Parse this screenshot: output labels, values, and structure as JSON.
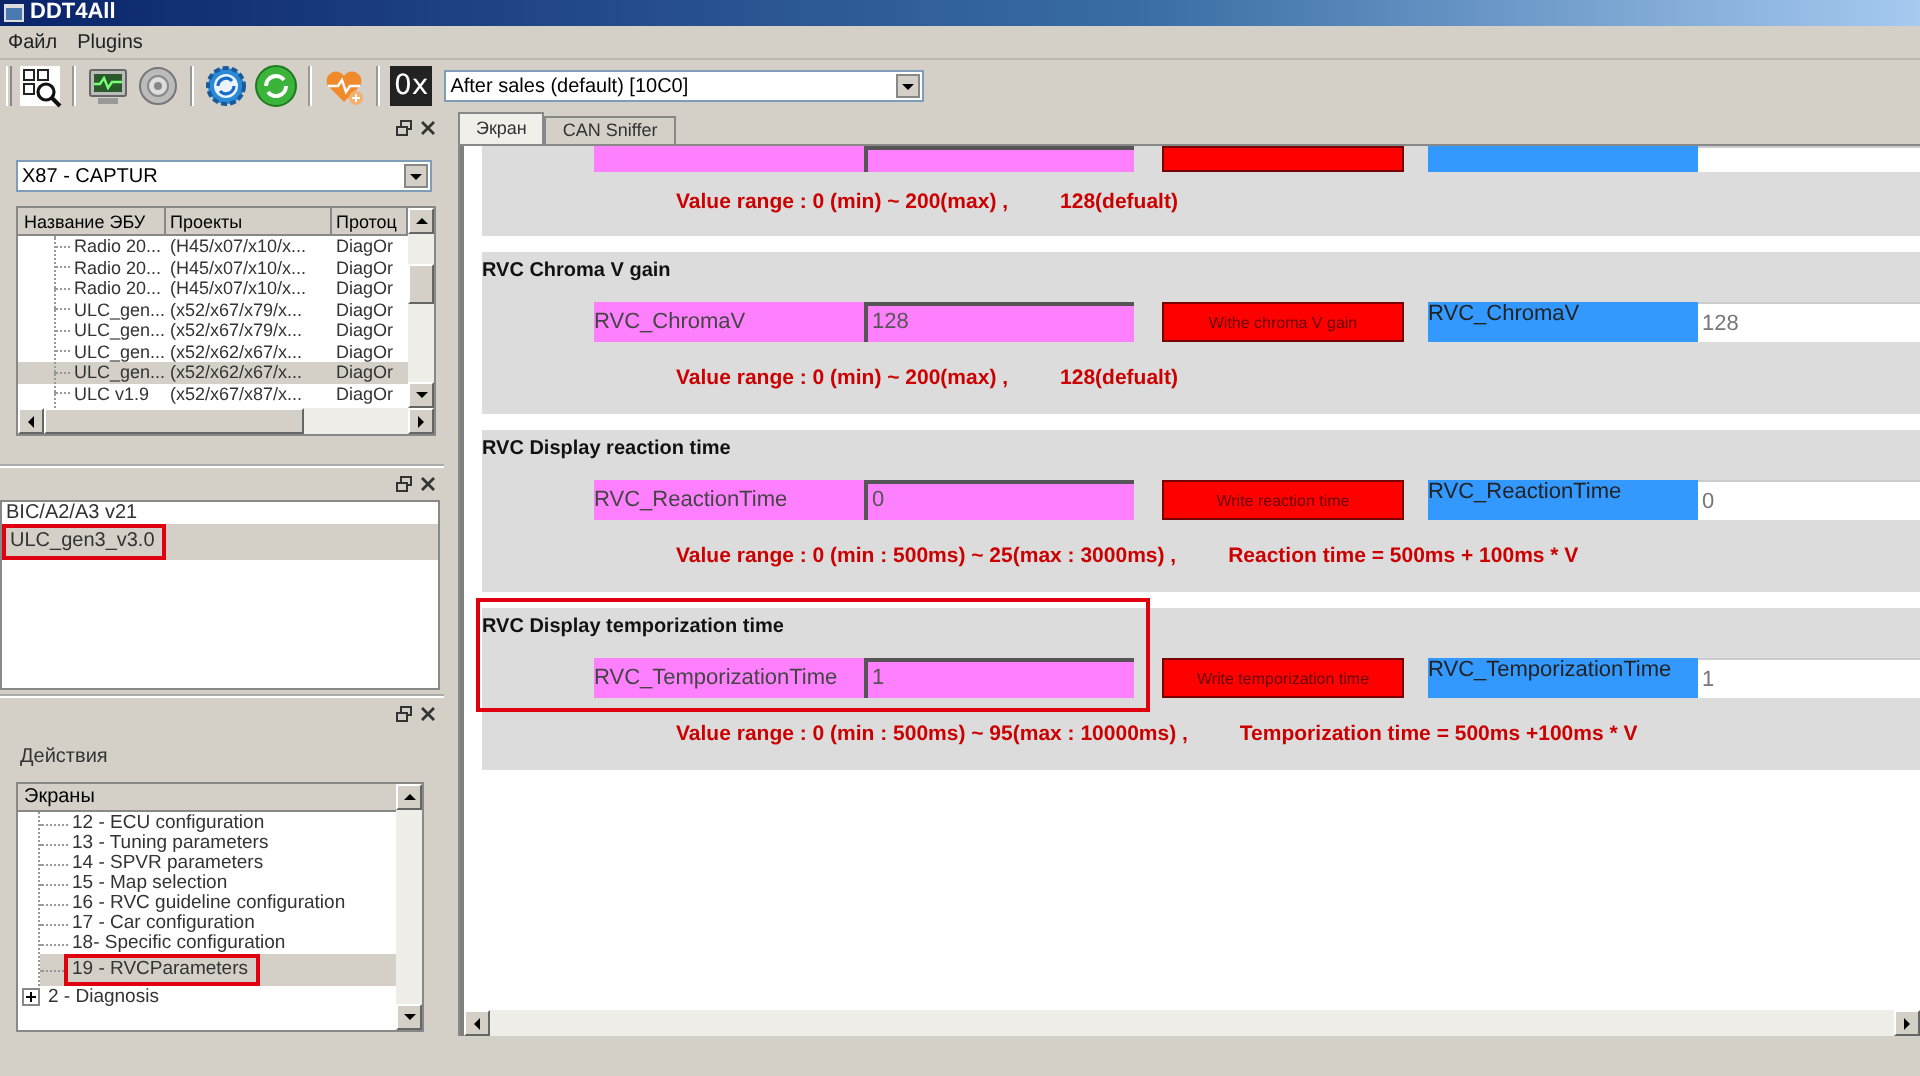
{
  "window": {
    "title": "DDT4All"
  },
  "menu": [
    {
      "label": "Файл"
    },
    {
      "label": "Plugins"
    }
  ],
  "toolbar": {
    "groups": [
      [
        {
          "kind": "scan"
        }
      ],
      [
        {
          "kind": "monitor"
        },
        {
          "kind": "disc"
        }
      ],
      [
        {
          "kind": "gear-sync"
        },
        {
          "kind": "sync"
        }
      ],
      [
        {
          "kind": "heart"
        }
      ],
      [
        {
          "kind": "hex",
          "label": "0x"
        }
      ]
    ],
    "session": "After sales (default) [10C0]"
  },
  "ecu_panel": {
    "vehicle": "X87 - CAPTUR",
    "columns": [
      "Название ЭБУ",
      "Проекты",
      "Протоц"
    ],
    "rows": [
      {
        "name": "Radio 20...",
        "projects": "(H45/x07/x10/x...",
        "protocol": "DiagOr",
        "selected": false
      },
      {
        "name": "Radio 20...",
        "projects": "(H45/x07/x10/x...",
        "protocol": "DiagOr",
        "selected": false
      },
      {
        "name": "Radio 20...",
        "projects": "(H45/x07/x10/x...",
        "protocol": "DiagOr",
        "selected": false
      },
      {
        "name": "ULC_gen...",
        "projects": "(x52/x67/x79/x...",
        "protocol": "DiagOr",
        "selected": false
      },
      {
        "name": "ULC_gen...",
        "projects": "(x52/x67/x79/x...",
        "protocol": "DiagOr",
        "selected": false
      },
      {
        "name": "ULC_gen...",
        "projects": "(x52/x62/x67/x...",
        "protocol": "DiagOr",
        "selected": false
      },
      {
        "name": "ULC_gen...",
        "projects": "(x52/x62/x67/x...",
        "protocol": "DiagOr",
        "selected": true
      },
      {
        "name": "ULC v1.9",
        "projects": "(x52/x67/x87/x...",
        "protocol": "DiagOr",
        "selected": false
      }
    ]
  },
  "ecu_list": {
    "items": [
      {
        "label": "BIC/A2/A3 v21",
        "selected": false,
        "annotated": false
      },
      {
        "label": "ULC_gen3_v3.0",
        "selected": true,
        "annotated": true
      }
    ]
  },
  "actions_panel": {
    "title": "Действия",
    "column": "Экраны",
    "nodes": [
      {
        "children": [
          {
            "label": "12 - ECU configuration",
            "selected": false,
            "annotated": false
          },
          {
            "label": "13 - Tuning parameters",
            "selected": false,
            "annotated": false
          },
          {
            "label": "14 - SPVR parameters",
            "selected": false,
            "annotated": false
          },
          {
            "label": "15 - Map selection",
            "selected": false,
            "annotated": false
          },
          {
            "label": "16 - RVC guideline configuration",
            "selected": false,
            "annotated": false
          },
          {
            "label": "17 - Car configuration",
            "selected": false,
            "annotated": false
          },
          {
            "label": "18- Specific configuration",
            "selected": false,
            "annotated": false
          },
          {
            "label": "19 - RVCParameters",
            "selected": true,
            "annotated": true
          }
        ]
      },
      {
        "label": "2 - Diagnosis",
        "expanded": false
      }
    ]
  },
  "tabs": [
    {
      "label": "Экран",
      "selected": true
    },
    {
      "label": "CAN Sniffer",
      "selected": false
    }
  ],
  "sections": [
    {
      "cut": true,
      "annotated": false,
      "range": "Value range : 0 (min) ~ 200(max) ,",
      "note": "128(defualt)"
    },
    {
      "cut": false,
      "annotated": false,
      "title": "RVC Chroma V gain",
      "label": "RVC_ChromaV",
      "value": "128",
      "button": "Withe chroma V gain",
      "reading_label": "RVC_ChromaV",
      "reading_value": "128",
      "range": "Value range : 0 (min) ~ 200(max) ,",
      "note": "128(defualt)"
    },
    {
      "cut": false,
      "annotated": false,
      "title": "RVC Display reaction time",
      "label": "RVC_ReactionTime",
      "value": "0",
      "button": "Write reaction time",
      "reading_label": "RVC_ReactionTime",
      "reading_value": "0",
      "range": "Value range : 0 (min : 500ms) ~ 25(max : 3000ms) ,",
      "note": "Reaction time = 500ms + 100ms * V"
    },
    {
      "cut": false,
      "annotated": true,
      "title": "RVC Display temporization time",
      "label": "RVC_TemporizationTime",
      "value": "1",
      "button": "Write temporization time",
      "reading_label": "RVC_TemporizationTime",
      "reading_value": "1",
      "range": "Value range : 0 (min : 500ms) ~ 95(max : 10000ms) ,",
      "note": "Temporization time = 500ms +100ms * V"
    }
  ]
}
